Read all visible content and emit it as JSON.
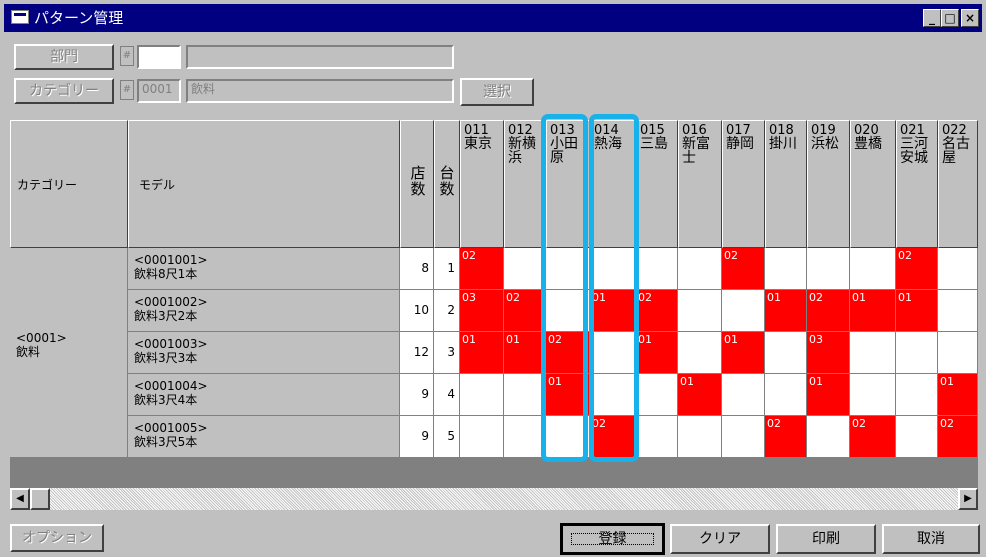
{
  "window": {
    "title": "パターン管理",
    "controls": [
      "_",
      "□",
      "×"
    ]
  },
  "filters": {
    "dept_label": "部門",
    "dept_code": "",
    "dept_name": "",
    "category_label": "カテゴリー",
    "category_code": "0001",
    "category_name": "飲料",
    "select_label": "選択",
    "hash": "#"
  },
  "table": {
    "col_category": "カテゴリー",
    "col_model": "モデル",
    "col_stores": "店数",
    "col_units": "台数",
    "stores": [
      {
        "code": "011",
        "name": "東京"
      },
      {
        "code": "012",
        "name": "新横浜"
      },
      {
        "code": "013",
        "name": "小田原"
      },
      {
        "code": "014",
        "name": "熱海"
      },
      {
        "code": "015",
        "name": "三島"
      },
      {
        "code": "016",
        "name": "新富士"
      },
      {
        "code": "017",
        "name": "静岡"
      },
      {
        "code": "018",
        "name": "掛川"
      },
      {
        "code": "019",
        "name": "浜松"
      },
      {
        "code": "020",
        "name": "豊橋"
      },
      {
        "code": "021",
        "name": "三河安城"
      },
      {
        "code": "022",
        "name": "名古屋"
      }
    ],
    "category_group": {
      "code": "<0001>",
      "name": "飲料"
    },
    "rows": [
      {
        "code": "<0001001>",
        "name": "飲料8尺1本",
        "stores": "8",
        "units": "1",
        "cells": [
          "02",
          "",
          "",
          "",
          "",
          "",
          "02",
          "",
          "",
          "",
          "02",
          ""
        ]
      },
      {
        "code": "<0001002>",
        "name": "飲料3尺2本",
        "stores": "10",
        "units": "2",
        "cells": [
          "03",
          "02",
          "",
          "01",
          "02",
          "",
          "",
          "01",
          "02",
          "01",
          "01",
          ""
        ]
      },
      {
        "code": "<0001003>",
        "name": "飲料3尺3本",
        "stores": "12",
        "units": "3",
        "cells": [
          "01",
          "01",
          "02",
          "",
          "01",
          "",
          "01",
          "",
          "03",
          "",
          "",
          ""
        ]
      },
      {
        "code": "<0001004>",
        "name": "飲料3尺4本",
        "stores": "9",
        "units": "4",
        "cells": [
          "",
          "",
          "01",
          "",
          "",
          "01",
          "",
          "",
          "01",
          "",
          "",
          "01"
        ]
      },
      {
        "code": "<0001005>",
        "name": "飲料3尺5本",
        "stores": "9",
        "units": "5",
        "cells": [
          "",
          "",
          "",
          "02",
          "",
          "",
          "",
          "02",
          "",
          "02",
          "",
          "02"
        ]
      }
    ]
  },
  "buttons": {
    "options": "オプション",
    "register": "登録",
    "clear": "クリア",
    "print": "印刷",
    "cancel": "取消"
  },
  "scroll": {
    "left": "◀",
    "right": "▶"
  },
  "highlight_color": "#18b1ea"
}
